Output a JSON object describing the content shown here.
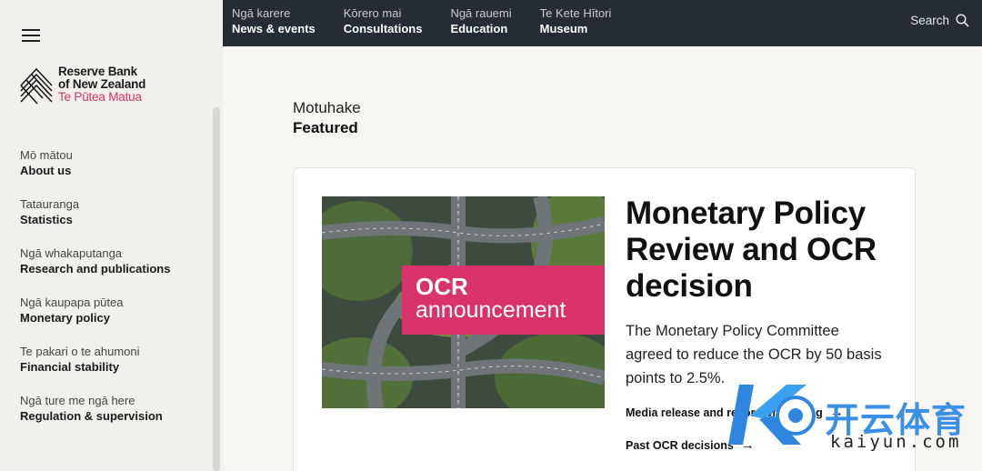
{
  "logo": {
    "line1": "Reserve Bank",
    "line2": "of New Zealand",
    "line3": "Te Pūtea Matua"
  },
  "sidebar": {
    "items": [
      {
        "mi": "Mō mātou",
        "en": "About us"
      },
      {
        "mi": "Tatauranga",
        "en": "Statistics"
      },
      {
        "mi": "Ngā whakaputanga",
        "en": "Research and publications"
      },
      {
        "mi": "Ngā kaupapa pūtea",
        "en": "Monetary policy"
      },
      {
        "mi": "Te pakari o te ahumoni",
        "en": "Financial stability"
      },
      {
        "mi": "Ngā ture me ngā here",
        "en": "Regulation & supervision"
      }
    ]
  },
  "topnav": {
    "items": [
      {
        "mi": "Ngā karere",
        "en": "News & events"
      },
      {
        "mi": "Kōrero mai",
        "en": "Consultations"
      },
      {
        "mi": "Ngā rauemi",
        "en": "Education"
      },
      {
        "mi": "Te Kete Hītori",
        "en": "Museum"
      }
    ],
    "search_label": "Search"
  },
  "featured": {
    "mi": "Motuhake",
    "en": "Featured"
  },
  "card": {
    "banner_line1": "OCR",
    "banner_line2": "announcement",
    "title": "Monetary Policy Review and OCR decision",
    "description": "The Monetary Policy Committee agreed to reduce the OCR by 50 basis points to 2.5%.",
    "link1": "Media release and record of meeting",
    "link2": "Past OCR decisions"
  },
  "watermark": {
    "cn": "开云体育",
    "en": "kaiyun.com"
  },
  "colors": {
    "accent": "#d8336a",
    "topbar": "#252c33",
    "background": "#f6f5f1"
  }
}
